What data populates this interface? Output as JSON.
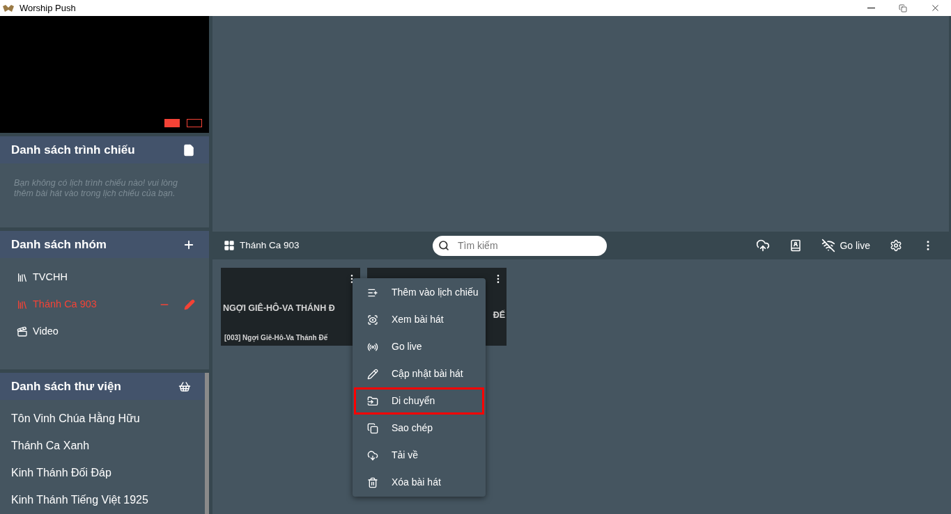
{
  "window": {
    "title": "Worship Push"
  },
  "schedule": {
    "title": "Danh sách trình chiếu",
    "empty_message": "Bạn không có lịch trình chiếu nào! vui lòng thêm bài hát vào trong lịch chiếu của bạn."
  },
  "groups": {
    "title": "Danh sách nhóm",
    "items": [
      {
        "label": "TVCHH",
        "kind": "list",
        "selected": false
      },
      {
        "label": "Thánh Ca 903",
        "kind": "list",
        "selected": true
      },
      {
        "label": "Video",
        "kind": "video",
        "selected": false
      }
    ]
  },
  "library": {
    "title": "Danh sách thư viện",
    "items": [
      "Tôn Vinh Chúa Hằng Hữu",
      "Thánh Ca Xanh",
      "Kinh Thánh Đối Đáp",
      "Kinh Thánh Tiếng Việt 1925"
    ]
  },
  "toolbar": {
    "group_name": "Thánh Ca 903",
    "search": {
      "placeholder": "Tìm kiếm"
    },
    "go_live": "Go live"
  },
  "cards": [
    {
      "title": "NGỢI GIÊ-HÔ-VA THÁNH Đ",
      "caption": "[003] Ngợi Giê-Hô-Va Thánh Đế"
    },
    {
      "title": "ĐẾ"
    }
  ],
  "context_menu": {
    "items": [
      {
        "kind": "add",
        "label": "Thêm vào lịch chiếu",
        "outlined": false
      },
      {
        "kind": "view",
        "label": "Xem bài hát",
        "outlined": false
      },
      {
        "kind": "live",
        "label": "Go live",
        "outlined": false
      },
      {
        "kind": "edit",
        "label": "Cập nhật bài hát",
        "outlined": false
      },
      {
        "kind": "move",
        "label": "Di chuyển",
        "outlined": true
      },
      {
        "kind": "copy",
        "label": "Sao chép",
        "outlined": false
      },
      {
        "kind": "download",
        "label": "Tải về",
        "outlined": false
      },
      {
        "kind": "delete",
        "label": "Xóa bài hát",
        "outlined": false
      }
    ]
  }
}
